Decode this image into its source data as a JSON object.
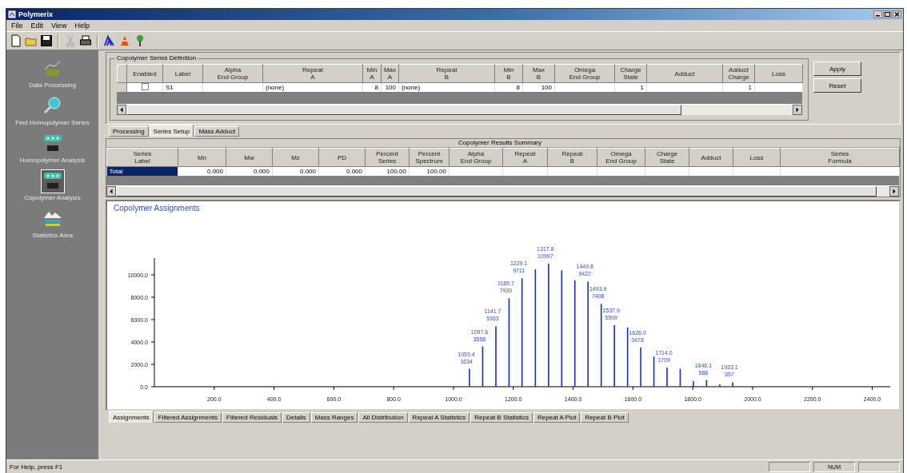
{
  "window": {
    "title": "Polymerix"
  },
  "menu": [
    "File",
    "Edit",
    "View",
    "Help"
  ],
  "sidebar": {
    "items": [
      {
        "label": "Data Processing",
        "selected": false
      },
      {
        "label": "Find Homopolymer Series",
        "selected": false
      },
      {
        "label": "Homopolymer Analysis",
        "selected": false
      },
      {
        "label": "Copolymer Analysis",
        "selected": true
      },
      {
        "label": "Statistics Area",
        "selected": false
      }
    ]
  },
  "series_definition": {
    "title": "Copolymer Series Definition",
    "columns": [
      {
        "title": "Enabled",
        "kind": "check"
      },
      {
        "title": "Label",
        "kind": "text"
      },
      {
        "title": "Alpha\nEnd Group",
        "kind": "text"
      },
      {
        "title": "Repeat\nA",
        "kind": "text"
      },
      {
        "title": "Min\nA",
        "kind": "num"
      },
      {
        "title": "Max\nA",
        "kind": "num"
      },
      {
        "title": "Repeat\nB",
        "kind": "text"
      },
      {
        "title": "Min\nB",
        "kind": "num"
      },
      {
        "title": "Max\nB",
        "kind": "num"
      },
      {
        "title": "Omega\nEnd Group",
        "kind": "text"
      },
      {
        "title": "Charge\nState",
        "kind": "num"
      },
      {
        "title": "Adduct",
        "kind": "text"
      },
      {
        "title": "Adduct\nCharge",
        "kind": "num"
      },
      {
        "title": "Loss",
        "kind": "text"
      }
    ],
    "rows": [
      {
        "cells": [
          false,
          "S1",
          null,
          "(none)",
          "8",
          "100",
          "(none)",
          "8",
          "100",
          null,
          "1",
          null,
          "1",
          null
        ]
      }
    ]
  },
  "buttons": [
    "Apply",
    "Reset"
  ],
  "tabs": [
    {
      "label": "Processing",
      "selected": false
    },
    {
      "label": "Series Setup",
      "selected": true
    },
    {
      "label": "Mass Adduct",
      "selected": false
    }
  ],
  "results": {
    "title": "Copolymer Results Summary",
    "columns": [
      {
        "title": "Series\nLabel",
        "kind": "text"
      },
      {
        "title": "Mn",
        "kind": "num"
      },
      {
        "title": "Mw",
        "kind": "num"
      },
      {
        "title": "Mz",
        "kind": "num"
      },
      {
        "title": "PD",
        "kind": "num"
      },
      {
        "title": "Percent\nSeries",
        "kind": "num"
      },
      {
        "title": "Percent\nSpectrum",
        "kind": "num"
      },
      {
        "title": "Alpha\nEnd Group",
        "kind": "text"
      },
      {
        "title": "Repeat\nA",
        "kind": "text"
      },
      {
        "title": "Repeat\nB",
        "kind": "text"
      },
      {
        "title": "Omega\nEnd Group",
        "kind": "text"
      },
      {
        "title": "Charge\nState",
        "kind": "text"
      },
      {
        "title": "Adduct",
        "kind": "text"
      },
      {
        "title": "Loss",
        "kind": "text"
      },
      {
        "title": "Series\nFormula",
        "kind": "text"
      }
    ],
    "rows": [
      {
        "selected": true,
        "cells": [
          "Total",
          "0.000",
          "0.000",
          "0.000",
          "0.000",
          "100.00",
          "100.00",
          null,
          null,
          null,
          null,
          null,
          null,
          null,
          null
        ]
      }
    ]
  },
  "chart": {
    "chart_data": {
      "type": "bar",
      "title": "Copolymer Assignments",
      "x": [
        1053.4,
        1097.6,
        1141.7,
        1185.7,
        1229.1,
        1273.7,
        1317.8,
        1361.8,
        1405.8,
        1449.8,
        1493.9,
        1537.9,
        1582.0,
        1626.0,
        1670.0,
        1714.0,
        1758.0,
        1802.0,
        1846.1,
        1890.0,
        1933.1
      ],
      "series": [
        {
          "color": "#1a2fc0",
          "values": [
            1600,
            3600,
            5400,
            7900,
            9700,
            10500,
            11000,
            10400,
            9500,
            9400,
            7400,
            5500,
            5300,
            3500,
            2700,
            1700,
            1600,
            500,
            600,
            200,
            400
          ]
        }
      ],
      "xlim": [
        0,
        2460
      ],
      "ylim": [
        0,
        11500
      ],
      "xticks": [
        {
          "value": 200,
          "label": "200.0"
        },
        {
          "value": 400,
          "label": "400.0"
        },
        {
          "value": 600,
          "label": "600.0"
        },
        {
          "value": 800,
          "label": "800.0"
        },
        {
          "value": 1000,
          "label": "1000.0"
        },
        {
          "value": 1200,
          "label": "1200.0"
        },
        {
          "value": 1400,
          "label": "1400.0"
        },
        {
          "value": 1600,
          "label": "1600.0"
        },
        {
          "value": 1800,
          "label": "1800.0"
        },
        {
          "value": 2000,
          "label": "2000.0"
        },
        {
          "value": 2200,
          "label": "2200.0"
        },
        {
          "value": 2400,
          "label": "2400.0"
        }
      ],
      "yticks": [
        {
          "value": 0,
          "label": "0.0"
        },
        {
          "value": 2000,
          "label": "2000.0"
        },
        {
          "value": 4000,
          "label": "4000.0"
        },
        {
          "value": 6000,
          "label": "6000.0"
        },
        {
          "value": 8000,
          "label": "8000.0"
        },
        {
          "value": 10000,
          "label": "10000.0"
        }
      ],
      "value_labels": [
        "1053.4\n1634",
        "1097.6\n3558",
        "1141.7\n5363",
        "1185.7\n7920",
        "1229.1\n9711",
        null,
        "1317.8\n10997",
        null,
        null,
        "1449.8\n9422",
        "1493.9\n7408",
        "1537.9\n5509",
        null,
        "1626.0\n3478",
        null,
        "1714.0\n1709",
        null,
        null,
        "1846.1\n588",
        null,
        "1933.1\n357"
      ]
    }
  },
  "bottom_tabs": [
    {
      "label": "Assignments",
      "selected": true
    },
    {
      "label": "Filtered Assignments",
      "selected": false
    },
    {
      "label": "Filtered Residuals",
      "selected": false
    },
    {
      "label": "Details",
      "selected": false
    },
    {
      "label": "Mass Ranges",
      "selected": false
    },
    {
      "label": "All Distribution",
      "selected": false
    },
    {
      "label": "Repeat A Statistics",
      "selected": false
    },
    {
      "label": "Repeat B Statistics",
      "selected": false
    },
    {
      "label": "Repeat A Plot",
      "selected": false
    },
    {
      "label": "Repeat B Plot",
      "selected": false
    }
  ],
  "status_bar": {
    "text": "For Help, press F1",
    "indicator": "NUM"
  }
}
